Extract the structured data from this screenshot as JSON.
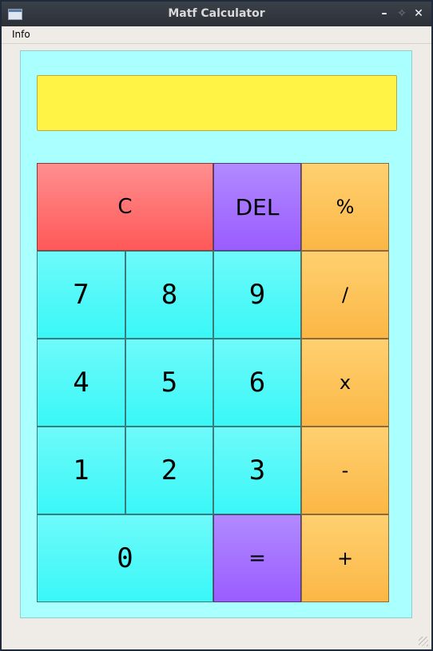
{
  "window": {
    "title": "Matf Calculator",
    "minimize_icon": "minimize-icon",
    "maximize_icon": "maximize-icon",
    "close_icon": "close-icon",
    "minimize_glyph": "–",
    "maximize_glyph": "✧",
    "close_glyph": "✕"
  },
  "menubar": {
    "items": [
      {
        "label": "Info"
      }
    ]
  },
  "display": {
    "value": ""
  },
  "buttons": {
    "clear": "C",
    "delete": "DEL",
    "percent": "%",
    "seven": "7",
    "eight": "8",
    "nine": "9",
    "divide": "/",
    "four": "4",
    "five": "5",
    "six": "6",
    "multiply": "x",
    "one": "1",
    "two": "2",
    "three": "3",
    "minus": "-",
    "zero": "0",
    "equals": "=",
    "plus": "+"
  },
  "colors": {
    "panel": "#aaffff",
    "display": "#fff445",
    "digit": "#3af7f7",
    "clear": "#ff6a6a",
    "delete_equals": "#9a5cff",
    "operators": "#fbb745"
  }
}
